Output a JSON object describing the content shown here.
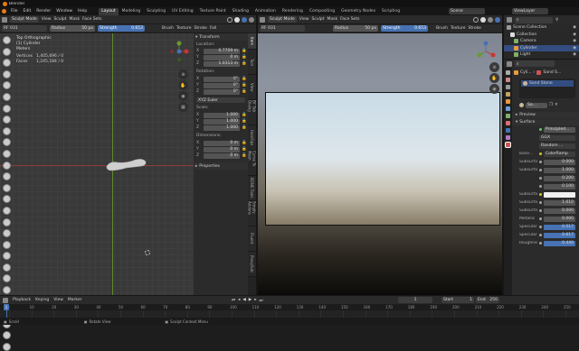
{
  "app": {
    "title": "Blender"
  },
  "menubar": {
    "menus": [
      "File",
      "Edit",
      "Render",
      "Window",
      "Help"
    ],
    "workspaces": [
      "Layout",
      "Modeling",
      "Sculpting",
      "UV Editing",
      "Texture Paint",
      "Shading",
      "Animation",
      "Rendering",
      "Compositing",
      "Geometry Nodes",
      "Scripting"
    ],
    "active_workspace": "Layout",
    "scene": "Scene",
    "view_layer": "ViewLayer"
  },
  "left_header": {
    "mode": "Sculpt Mode",
    "menus": [
      "View",
      "Sculpt",
      "Mask",
      "Face Sets"
    ]
  },
  "left_tool_header": {
    "brush": "RF 031",
    "radius_label": "Radius",
    "radius_value": "50 px",
    "strength_label": "Strength",
    "strength_value": "0.653",
    "brush_menu": "Brush",
    "texture_menu": "Texture",
    "stroke_menu": "Stroke",
    "falloff_menu": "Fall"
  },
  "left_viewport": {
    "overlay_title": "Top Orthographic",
    "overlay_object": "(1) Cylinder",
    "overlay_units": "Meters",
    "vertices_label": "Vertices",
    "vertices_value": "1,405,696 / 0",
    "faces_label": "Faces",
    "faces_value": "1,245,184 / 0"
  },
  "n_panel": {
    "transform_title": "Transform",
    "location_label": "Location:",
    "location": [
      {
        "axis": "X",
        "value": "0.7709 m"
      },
      {
        "axis": "Y",
        "value": "0 m"
      },
      {
        "axis": "Z",
        "value": "1.0313 m"
      }
    ],
    "rotation_label": "Rotation:",
    "rotation": [
      {
        "axis": "X",
        "value": "0°"
      },
      {
        "axis": "Y",
        "value": "0°"
      },
      {
        "axis": "Z",
        "value": "0°"
      }
    ],
    "rotation_mode": "XYZ Euler",
    "scale_label": "Scale:",
    "scale": [
      {
        "axis": "X",
        "value": "1.000"
      },
      {
        "axis": "Y",
        "value": "1.000"
      },
      {
        "axis": "Z",
        "value": "1.000"
      }
    ],
    "dimensions_label": "Dimensions:",
    "dimensions": [
      {
        "axis": "X",
        "value": "0 m"
      },
      {
        "axis": "Y",
        "value": "0 m"
      },
      {
        "axis": "Z",
        "value": "0 m"
      }
    ],
    "properties_title": "Properties"
  },
  "n_tabs_left": [
    "Item",
    "Tool",
    "View",
    "BY Tab Dialog",
    "HardOps",
    "Curve To Mesh",
    "BONE Tools",
    "Simply Addons",
    "Fluent",
    "ProxySub"
  ],
  "right_header": {
    "mode": "Sculpt Mode",
    "menus": [
      "View",
      "Sculpt",
      "Mask",
      "Face Sets"
    ]
  },
  "right_tool_header": {
    "brush": "RF 031",
    "radius_label": "Radius",
    "radius_value": "50 px",
    "strength_label": "Strength",
    "strength_value": "0.653",
    "brush_menu": "Brush",
    "texture_menu": "Texture",
    "stroke_menu": "Stroke"
  },
  "outliner": {
    "items": [
      {
        "label": "Scene Collection",
        "indent": 0,
        "color": "#999999"
      },
      {
        "label": "Collection",
        "indent": 1,
        "color": "#dddddd"
      },
      {
        "label": "Camera",
        "indent": 2,
        "color": "#7fb069"
      },
      {
        "label": "Cylinder",
        "indent": 2,
        "color": "#e89a3c"
      },
      {
        "label": "Light",
        "indent": 2,
        "color": "#7fb069"
      }
    ],
    "selected_index": 3
  },
  "properties": {
    "object_name": "Cyli...",
    "material_name": "Sand S...",
    "slot_label": "Sand Stone",
    "surface_tab": "Sa...",
    "preview_label": "Preview",
    "surface_label": "Surface",
    "surface_value": "Principled...",
    "distribution": "GGX",
    "subsurface_method": "Random ...",
    "rows": [
      {
        "label": "Base...",
        "value": "ColorRamp"
      },
      {
        "label": "Subsurfa...",
        "value": "0.000"
      },
      {
        "label": "Subsurfa...",
        "value": "1.000"
      },
      {
        "label": "",
        "value": "0.200"
      },
      {
        "label": "",
        "value": "0.100"
      },
      {
        "label": "Subsurfa...",
        "value": ""
      },
      {
        "label": "Subsurfa...",
        "value": "1.010"
      },
      {
        "label": "Subsurfa...",
        "value": "0.000"
      },
      {
        "label": "Metallic",
        "value": "0.000"
      },
      {
        "label": "Specular",
        "value": "0.517"
      },
      {
        "label": "Specular",
        "value": "0.617"
      },
      {
        "label": "Roughness",
        "value": "0.440"
      }
    ]
  },
  "timeline": {
    "menus": [
      "Playback",
      "Keying",
      "View",
      "Marker"
    ],
    "current_frame": "1",
    "start_label": "Start",
    "start_value": "1",
    "end_label": "End",
    "end_value": "250",
    "ticks": [
      "0",
      "10",
      "20",
      "30",
      "40",
      "50",
      "60",
      "70",
      "80",
      "90",
      "100",
      "110",
      "120",
      "130",
      "140",
      "150",
      "160",
      "170",
      "180",
      "190",
      "200",
      "210",
      "220",
      "230",
      "240",
      "250"
    ]
  },
  "statusbar": {
    "left": "Scroll",
    "middle": "Rotate View",
    "right": "Sculpt Context Menu"
  },
  "colors": {
    "accent": "#4772b3",
    "panel": "#2a2a2a",
    "viewport_grid": "#393939",
    "selected_row": "#334d80"
  }
}
